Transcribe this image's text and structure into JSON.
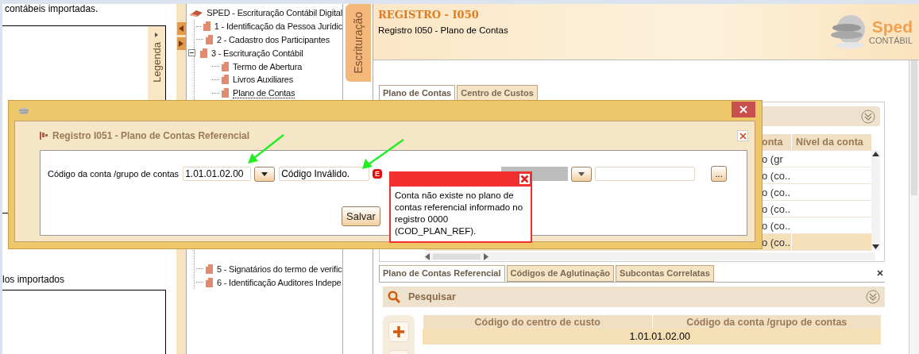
{
  "left_panel": {
    "top_text": "contábeis importadas.",
    "legend_tab": "Legenda",
    "bottom_text": "los importados"
  },
  "tree": {
    "items": [
      {
        "label": "SPED - Escrituração Contábil Digital",
        "selected": false,
        "children": [
          {
            "label": "1 - Identificação da Pessoa Jurídic",
            "selected": false
          },
          {
            "label": "2 - Cadastro dos Participantes",
            "selected": false
          },
          {
            "label": "3 - Escrituração Contábil",
            "selected": false,
            "expanded": true,
            "children": [
              {
                "label": "Termo de Abertura",
                "selected": false
              },
              {
                "label": "Livros Auxiliares",
                "selected": false
              },
              {
                "label": "Plano de Contas",
                "selected": true
              }
            ]
          },
          {
            "label": "5 - Signatários do termo de verific",
            "selected": false
          },
          {
            "label": "6 - Identificação Auditores Indepe",
            "selected": false
          }
        ]
      }
    ]
  },
  "side_tab": "Escrituração",
  "header": {
    "title": "REGISTRO - I050",
    "subtitle": "Registro I050 - Plano de Contas",
    "logo_main": "Sped",
    "logo_sub": "CONTÁBIL"
  },
  "top_tabs": [
    {
      "label": "Plano de Contas",
      "selected": true
    },
    {
      "label": "Centro de Custos",
      "selected": false
    }
  ],
  "accounts_grid": {
    "columns": [
      "onta",
      "Nível da conta"
    ],
    "rows": [
      {
        "cells": [
          "o (gr",
          ""
        ],
        "selected": false
      },
      {
        "cells": [
          "o (co...",
          ""
        ],
        "selected": false
      },
      {
        "cells": [
          "o (co...",
          ""
        ],
        "selected": false
      },
      {
        "cells": [
          "o (co...",
          ""
        ],
        "selected": false
      },
      {
        "cells": [
          "o (co...",
          ""
        ],
        "selected": false
      },
      {
        "cells": [
          "o (co...",
          ""
        ],
        "selected": true
      }
    ]
  },
  "bottom_tabs": [
    {
      "label": "Plano de Contas Referencial",
      "selected": true
    },
    {
      "label": "Códigos de Aglutinação",
      "selected": false
    },
    {
      "label": "Subcontas Correlatas",
      "selected": false
    }
  ],
  "search": {
    "title": "Pesquisar"
  },
  "bottom_table": {
    "columns": [
      "Código do centro de custo",
      "Código da conta /grupo de contas"
    ],
    "rows": [
      {
        "cells": [
          "",
          "1.01.01.02.00"
        ]
      }
    ]
  },
  "dialog": {
    "title": "Registro I051 - Plano de Contas Referencial",
    "field_label": "Código da conta /grupo de contas",
    "code_value": "1.01.01.02.00",
    "description_value": "Código Inválido.",
    "error_badge": "E",
    "lookup_button": "...",
    "save_button": "Salvar",
    "error_popup": {
      "message": "Conta não existe no plano de contas referencial informado no registro 0000 (COD_PLAN_REF)."
    }
  }
}
